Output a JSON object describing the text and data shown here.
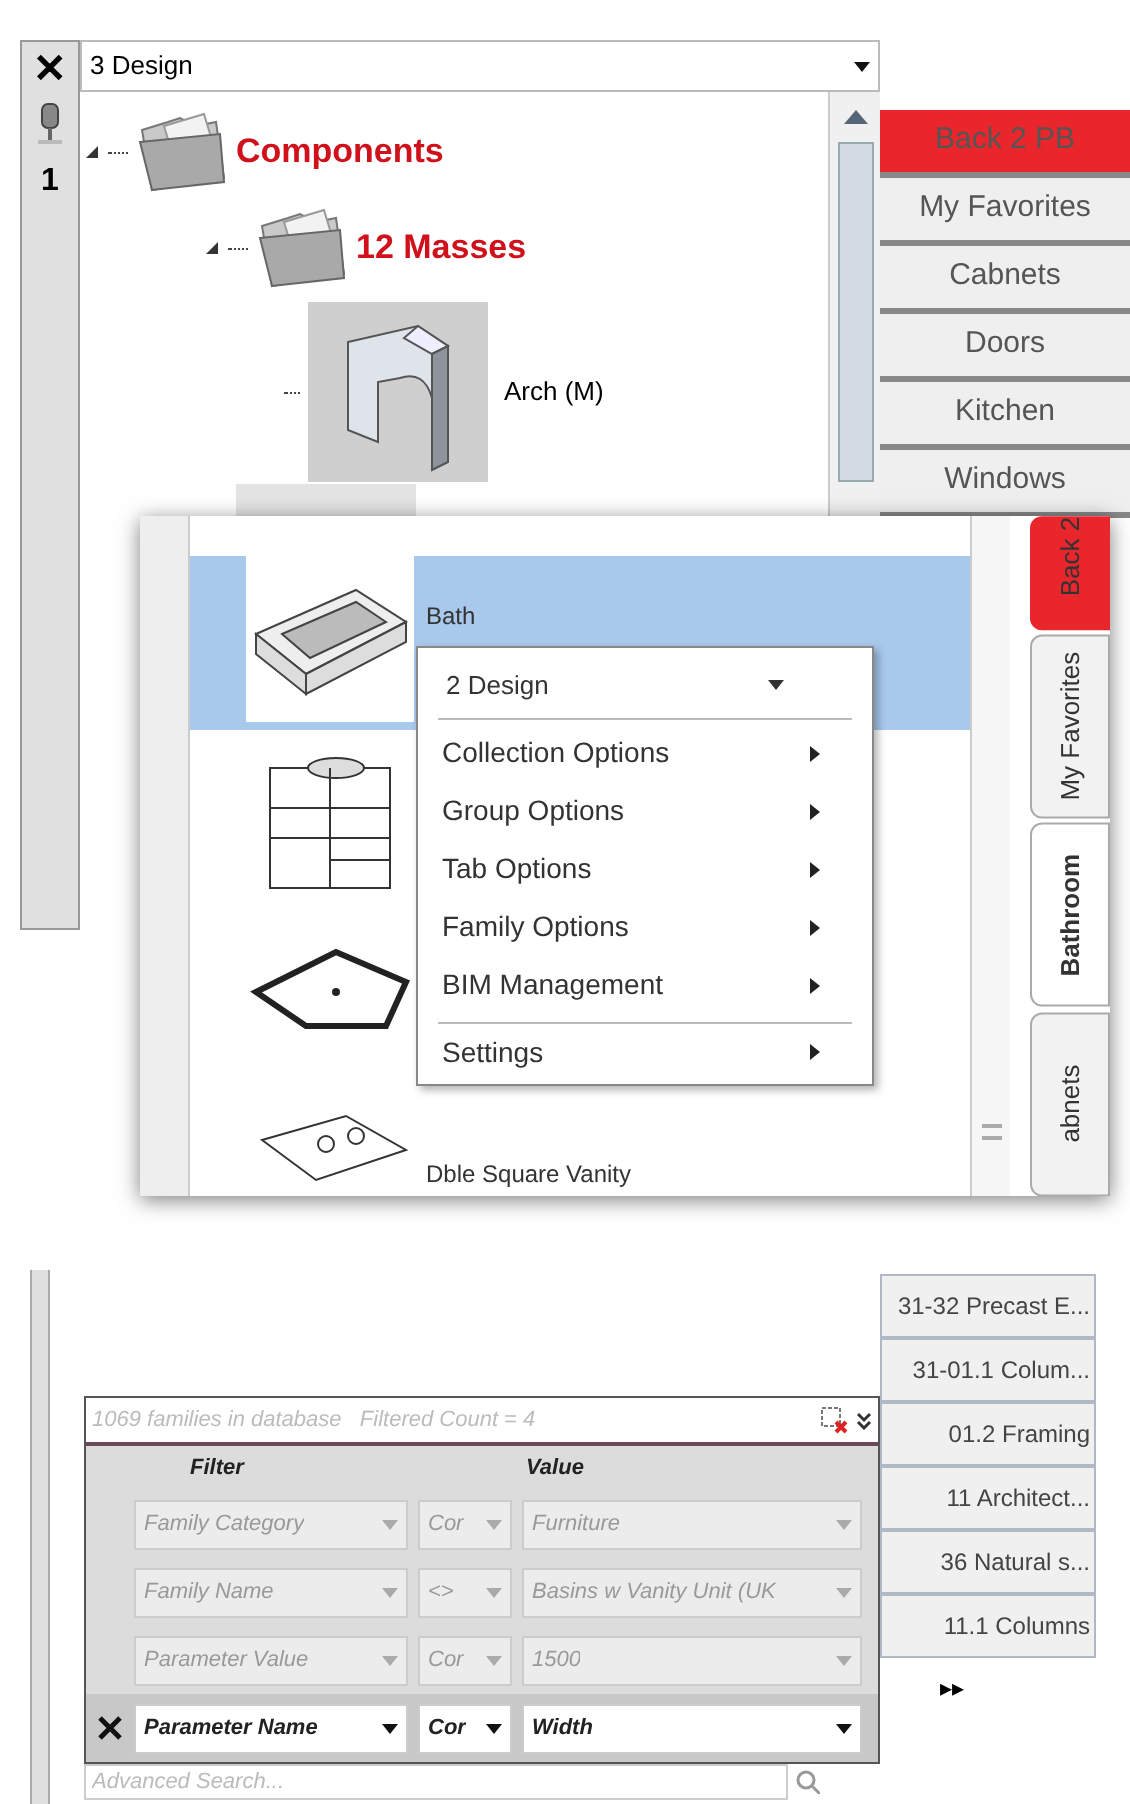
{
  "browser_panel": {
    "close": "✕",
    "pin_count": "1",
    "design_dropdown": "3 Design",
    "tree": [
      {
        "label": "Components",
        "kind": "folder",
        "expanded": true,
        "children": [
          {
            "label": "12 Masses",
            "kind": "folder",
            "expanded": true,
            "children": [
              {
                "label": "Arch (M)",
                "kind": "family"
              }
            ]
          }
        ]
      }
    ],
    "tabs": [
      {
        "label": "Back 2 PB",
        "kind": "back"
      },
      {
        "label": "My Favorites",
        "kind": "tab"
      },
      {
        "label": "Cabnets",
        "kind": "tab"
      },
      {
        "label": "Doors",
        "kind": "tab"
      },
      {
        "label": "Kitchen",
        "kind": "tab"
      },
      {
        "label": "Windows",
        "kind": "tab"
      }
    ]
  },
  "context_panel": {
    "families": [
      {
        "label": "Bath",
        "selected": true
      },
      {
        "selected": false
      },
      {
        "selected": false
      },
      {
        "label": "Dble Square Vanity",
        "selected": false
      }
    ],
    "menu": {
      "dropdown": "2 Design",
      "items": [
        {
          "label": "Collection Options",
          "separated": false
        },
        {
          "label": "Group Options",
          "separated": false
        },
        {
          "label": "Tab Options",
          "separated": false
        },
        {
          "label": "Family Options",
          "separated": false
        },
        {
          "label": "BIM Management",
          "separated": false
        },
        {
          "label": "Settings",
          "separated": true
        }
      ]
    },
    "tabs": [
      {
        "label": "Back 2",
        "kind": "back",
        "selected": false
      },
      {
        "label": "My Favorites",
        "kind": "tab",
        "selected": false
      },
      {
        "label": "Bathroom",
        "kind": "tab",
        "selected": true
      },
      {
        "label": "abnets",
        "kind": "tab",
        "selected": false
      }
    ]
  },
  "filter_panel": {
    "tabs": [
      "31-32 Precast E...",
      "31-01.1 Colum...",
      "01.2 Framing",
      "11 Architect...",
      "36 Natural s...",
      "11.1 Columns"
    ],
    "more": "▸▸",
    "status": "1069 families in database   Filtered Count = 4",
    "columns": [
      "Filter",
      "Value"
    ],
    "rows": [
      {
        "filter": "Family Category",
        "operator": "Cor",
        "value": "Furniture",
        "active": false
      },
      {
        "filter": "Family Name",
        "operator": "<>",
        "value": "Basins w Vanity Unit (UK",
        "active": false
      },
      {
        "filter": "Parameter Value",
        "operator": "Cor",
        "value": "1500",
        "active": false
      },
      {
        "filter": "Parameter Name",
        "operator": "Cor",
        "value": "Width",
        "active": true
      }
    ],
    "search_placeholder": "Advanced Search..."
  }
}
